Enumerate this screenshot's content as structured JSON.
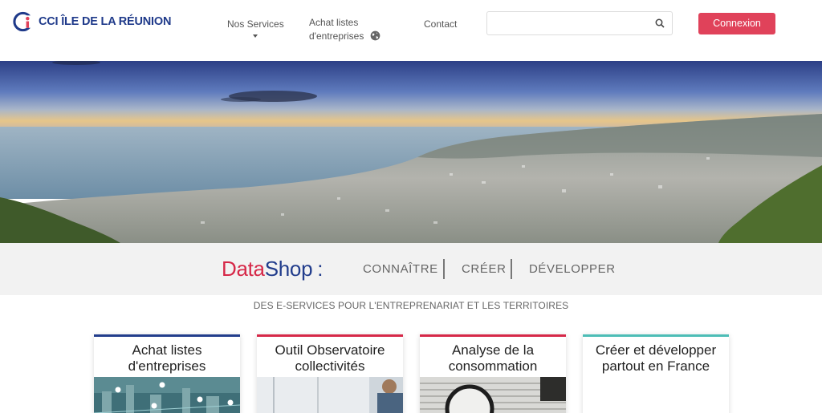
{
  "brand": {
    "name": "CCI ÎLE DE LA RÉUNION",
    "primary_color": "#1f3a8a",
    "accent_color": "#e0425a"
  },
  "nav": {
    "services": "Nos Services",
    "achat_line1": "Achat listes",
    "achat_line2": "d'entreprises",
    "contact": "Contact"
  },
  "search": {
    "placeholder": "",
    "icon": "search-icon"
  },
  "login": {
    "label": "Connexion"
  },
  "datashop": {
    "title_part1": "Data",
    "title_part2": "Shop",
    "colon": ":",
    "links": [
      "CONNAÎTRE",
      "CRÉER",
      "DÉVELOPPER"
    ]
  },
  "tagline": "DES E-SERVICES POUR L'ENTREPRENARIAT ET LES TERRITOIRES",
  "cards": [
    {
      "title_line1": "Achat listes",
      "title_line2": "d'entreprises",
      "bar_color": "#223d8c"
    },
    {
      "title_line1": "Outil Observatoire",
      "title_line2": "collectivités",
      "bar_color": "#d62848"
    },
    {
      "title_line1": "Analyse de la",
      "title_line2": "consommation",
      "bar_color": "#d62848"
    },
    {
      "title_line1": "Créer et développer",
      "title_line2": "partout en France",
      "bar_color": "#4dbdb6"
    }
  ]
}
